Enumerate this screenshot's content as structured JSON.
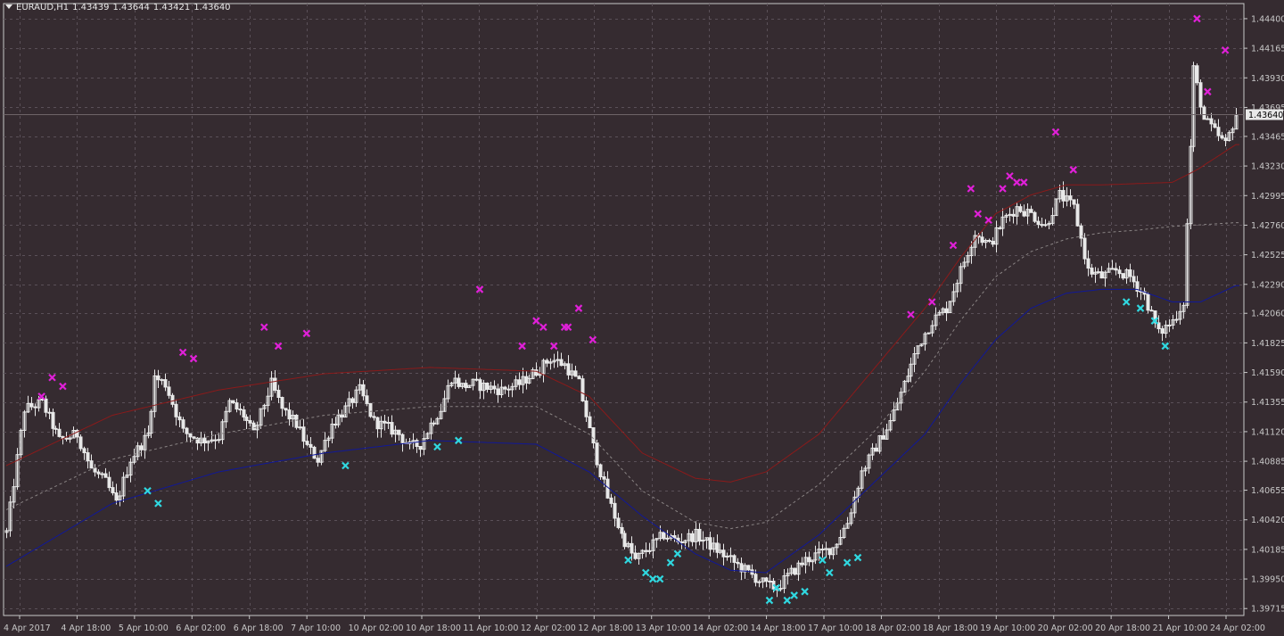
{
  "header": {
    "symbol": "EURAUD,H1",
    "open": "1.43439",
    "high": "1.43644",
    "low": "1.43421",
    "close": "1.43640"
  },
  "colors": {
    "background": "#352B30",
    "grid": "#5A5058",
    "axis": "#C8C8C8",
    "candle": "#E8E8E8",
    "upper_band": "#8B1A1A",
    "middle_band": "#8A8484",
    "lower_band": "#101898",
    "sell_marker": "#E020D8",
    "buy_marker": "#30D8E0",
    "price_tag_bg": "#E8E8E8",
    "price_tag_text": "#000000"
  },
  "chart_data": {
    "type": "candlestick",
    "title": "EURAUD,H1",
    "ylim": [
      1.3966,
      1.4452
    ],
    "y_ticks": [
      "1.44400",
      "1.44165",
      "1.43930",
      "1.43695",
      "1.43465",
      "1.43230",
      "1.42995",
      "1.42760",
      "1.42525",
      "1.42290",
      "1.42060",
      "1.41825",
      "1.41590",
      "1.41355",
      "1.41120",
      "1.40885",
      "1.40655",
      "1.40420",
      "1.40185",
      "1.39950",
      "1.39715"
    ],
    "x_ticks": [
      "4 Apr 2017",
      "4 Apr 18:00",
      "5 Apr 10:00",
      "6 Apr 02:00",
      "6 Apr 18:00",
      "7 Apr 10:00",
      "10 Apr 02:00",
      "10 Apr 18:00",
      "11 Apr 10:00",
      "12 Apr 02:00",
      "12 Apr 18:00",
      "13 Apr 10:00",
      "14 Apr 02:00",
      "14 Apr 18:00",
      "17 Apr 10:00",
      "18 Apr 02:00",
      "18 Apr 18:00",
      "19 Apr 10:00",
      "20 Apr 02:00",
      "20 Apr 18:00",
      "21 Apr 10:00",
      "24 Apr 02:00"
    ],
    "current_price": "1.43640",
    "price_path": [
      [
        0,
        1.4032
      ],
      [
        5,
        1.413
      ],
      [
        10,
        1.4135
      ],
      [
        15,
        1.4105
      ],
      [
        20,
        1.411
      ],
      [
        24,
        1.4082
      ],
      [
        28,
        1.4072
      ],
      [
        31,
        1.4055
      ],
      [
        35,
        1.409
      ],
      [
        40,
        1.411
      ],
      [
        42,
        1.4155
      ],
      [
        45,
        1.415
      ],
      [
        50,
        1.4112
      ],
      [
        55,
        1.4105
      ],
      [
        60,
        1.4108
      ],
      [
        63,
        1.4135
      ],
      [
        67,
        1.4125
      ],
      [
        70,
        1.411
      ],
      [
        75,
        1.415
      ],
      [
        78,
        1.413
      ],
      [
        82,
        1.4118
      ],
      [
        85,
        1.41
      ],
      [
        88,
        1.409
      ],
      [
        92,
        1.4118
      ],
      [
        96,
        1.413
      ],
      [
        100,
        1.4145
      ],
      [
        104,
        1.412
      ],
      [
        108,
        1.4115
      ],
      [
        111,
        1.411
      ],
      [
        114,
        1.41
      ],
      [
        117,
        1.4102
      ],
      [
        120,
        1.4118
      ],
      [
        123,
        1.413
      ],
      [
        126,
        1.4155
      ],
      [
        129,
        1.4148
      ],
      [
        132,
        1.415
      ],
      [
        135,
        1.4148
      ],
      [
        140,
        1.4145
      ],
      [
        145,
        1.415
      ],
      [
        150,
        1.416
      ],
      [
        154,
        1.417
      ],
      [
        158,
        1.4165
      ],
      [
        162,
        1.415
      ],
      [
        166,
        1.41
      ],
      [
        170,
        1.406
      ],
      [
        174,
        1.403
      ],
      [
        178,
        1.401
      ],
      [
        182,
        1.402
      ],
      [
        186,
        1.403
      ],
      [
        190,
        1.4025
      ],
      [
        195,
        1.403
      ],
      [
        200,
        1.402
      ],
      [
        205,
        1.401
      ],
      [
        210,
        1.4
      ],
      [
        215,
        1.399
      ],
      [
        218,
        1.3988
      ],
      [
        222,
        1.4
      ],
      [
        226,
        1.401
      ],
      [
        230,
        1.4015
      ],
      [
        234,
        1.402
      ],
      [
        238,
        1.404
      ],
      [
        242,
        1.408
      ],
      [
        246,
        1.41
      ],
      [
        250,
        1.412
      ],
      [
        254,
        1.415
      ],
      [
        258,
        1.418
      ],
      [
        262,
        1.42
      ],
      [
        266,
        1.421
      ],
      [
        270,
        1.424
      ],
      [
        274,
        1.427
      ],
      [
        278,
        1.426
      ],
      [
        282,
        1.428
      ],
      [
        286,
        1.429
      ],
      [
        290,
        1.4285
      ],
      [
        294,
        1.4275
      ],
      [
        298,
        1.43
      ],
      [
        302,
        1.429
      ],
      [
        306,
        1.424
      ],
      [
        310,
        1.4235
      ],
      [
        314,
        1.424
      ],
      [
        318,
        1.4235
      ],
      [
        322,
        1.422
      ],
      [
        326,
        1.419
      ],
      [
        330,
        1.42
      ],
      [
        333,
        1.4215
      ],
      [
        336,
        1.44
      ],
      [
        339,
        1.436
      ],
      [
        342,
        1.435
      ],
      [
        345,
        1.434
      ],
      [
        348,
        1.4364
      ]
    ],
    "series": [
      {
        "name": "upper_band",
        "points": [
          [
            0,
            1.4085
          ],
          [
            30,
            1.4125
          ],
          [
            60,
            1.4145
          ],
          [
            90,
            1.4158
          ],
          [
            120,
            1.4163
          ],
          [
            150,
            1.416
          ],
          [
            165,
            1.414
          ],
          [
            180,
            1.4095
          ],
          [
            195,
            1.4075
          ],
          [
            205,
            1.4072
          ],
          [
            215,
            1.408
          ],
          [
            230,
            1.411
          ],
          [
            245,
            1.416
          ],
          [
            260,
            1.421
          ],
          [
            270,
            1.425
          ],
          [
            280,
            1.4285
          ],
          [
            290,
            1.43
          ],
          [
            300,
            1.4308
          ],
          [
            310,
            1.4308
          ],
          [
            330,
            1.431
          ],
          [
            337,
            1.432
          ],
          [
            348,
            1.434
          ]
        ]
      },
      {
        "name": "middle_band",
        "points": [
          [
            0,
            1.405
          ],
          [
            30,
            1.409
          ],
          [
            60,
            1.411
          ],
          [
            90,
            1.4125
          ],
          [
            120,
            1.4132
          ],
          [
            150,
            1.4132
          ],
          [
            165,
            1.411
          ],
          [
            180,
            1.4065
          ],
          [
            195,
            1.404
          ],
          [
            205,
            1.4035
          ],
          [
            215,
            1.404
          ],
          [
            230,
            1.407
          ],
          [
            245,
            1.411
          ],
          [
            260,
            1.416
          ],
          [
            270,
            1.42
          ],
          [
            280,
            1.4235
          ],
          [
            290,
            1.4255
          ],
          [
            300,
            1.4265
          ],
          [
            310,
            1.427
          ],
          [
            320,
            1.4272
          ],
          [
            330,
            1.4275
          ],
          [
            348,
            1.4278
          ]
        ]
      },
      {
        "name": "lower_band",
        "points": [
          [
            0,
            1.4005
          ],
          [
            30,
            1.4055
          ],
          [
            60,
            1.408
          ],
          [
            90,
            1.4095
          ],
          [
            120,
            1.4105
          ],
          [
            150,
            1.4102
          ],
          [
            165,
            1.408
          ],
          [
            180,
            1.4045
          ],
          [
            195,
            1.4015
          ],
          [
            205,
            1.4002
          ],
          [
            215,
            1.4
          ],
          [
            230,
            1.403
          ],
          [
            245,
            1.407
          ],
          [
            260,
            1.411
          ],
          [
            270,
            1.415
          ],
          [
            280,
            1.4185
          ],
          [
            290,
            1.421
          ],
          [
            300,
            1.4222
          ],
          [
            310,
            1.4225
          ],
          [
            320,
            1.4225
          ],
          [
            330,
            1.4215
          ],
          [
            338,
            1.4215
          ],
          [
            348,
            1.4228
          ]
        ]
      }
    ],
    "sell_signals": [
      [
        10,
        1.414
      ],
      [
        13,
        1.4155
      ],
      [
        16,
        1.4148
      ],
      [
        50,
        1.4175
      ],
      [
        53,
        1.417
      ],
      [
        73,
        1.4195
      ],
      [
        77,
        1.418
      ],
      [
        85,
        1.419
      ],
      [
        134,
        1.4225
      ],
      [
        146,
        1.418
      ],
      [
        150,
        1.42
      ],
      [
        152,
        1.4195
      ],
      [
        155,
        1.418
      ],
      [
        158,
        1.4195
      ],
      [
        159,
        1.4195
      ],
      [
        162,
        1.421
      ],
      [
        166,
        1.4185
      ],
      [
        256,
        1.4205
      ],
      [
        262,
        1.4215
      ],
      [
        268,
        1.426
      ],
      [
        273,
        1.4305
      ],
      [
        275,
        1.4285
      ],
      [
        278,
        1.428
      ],
      [
        282,
        1.4305
      ],
      [
        284,
        1.4315
      ],
      [
        286,
        1.431
      ],
      [
        288,
        1.431
      ],
      [
        297,
        1.435
      ],
      [
        302,
        1.432
      ],
      [
        337,
        1.444
      ],
      [
        340,
        1.4382
      ],
      [
        345,
        1.4415
      ]
    ],
    "buy_signals": [
      [
        40,
        1.4065
      ],
      [
        43,
        1.4055
      ],
      [
        96,
        1.4085
      ],
      [
        122,
        1.41
      ],
      [
        128,
        1.4105
      ],
      [
        176,
        1.401
      ],
      [
        181,
        1.4
      ],
      [
        183,
        1.3995
      ],
      [
        185,
        1.3995
      ],
      [
        188,
        1.4008
      ],
      [
        190,
        1.4015
      ],
      [
        216,
        1.3978
      ],
      [
        218,
        1.3988
      ],
      [
        221,
        1.3978
      ],
      [
        223,
        1.3982
      ],
      [
        226,
        1.3985
      ],
      [
        231,
        1.401
      ],
      [
        233,
        1.4
      ],
      [
        238,
        1.4008
      ],
      [
        241,
        1.4012
      ],
      [
        317,
        1.4215
      ],
      [
        321,
        1.421
      ],
      [
        325,
        1.42
      ],
      [
        328,
        1.418
      ]
    ]
  }
}
